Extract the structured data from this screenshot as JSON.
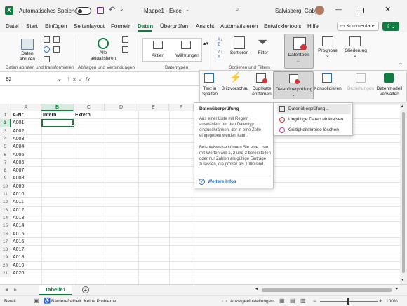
{
  "titlebar": {
    "autosave_label": "Automatisches Speichern",
    "doc_title": "Mappe1 - Excel",
    "user_name": "Salvisberg, Gaby"
  },
  "menu": {
    "tabs": [
      "Datei",
      "Start",
      "Einfügen",
      "Seitenlayout",
      "Formeln",
      "Daten",
      "Überprüfen",
      "Ansicht",
      "Automatisieren",
      "Entwicklertools",
      "Hilfe"
    ],
    "active": "Daten",
    "comments_label": "Kommentare"
  },
  "ribbon": {
    "get_data_label": "Daten abrufen",
    "refresh_all_label": "Alle aktualisieren",
    "stocks_label": "Aktien",
    "currencies_label": "Währungen",
    "sort_label": "Sortieren",
    "filter_label": "Filter",
    "datatools_label": "Datentools",
    "forecast_label": "Prognose",
    "outline_label": "Gliederung",
    "groups": {
      "get_transform": "Daten abrufen und transformieren",
      "queries": "Abfragen und Verbindungen",
      "datatypes": "Datentypen",
      "sort_filter": "Sortieren und Filtern"
    }
  },
  "subribbon": {
    "text_to_columns": "Text in Spalten",
    "flash_fill": "Blitzvorschau",
    "remove_duplicates": "Duplikate entfernen",
    "data_validation": "Datenüberprüfung",
    "consolidate": "Konsolidieren",
    "relationships": "Beziehungen",
    "data_model": "Datenmodell verwalten"
  },
  "formulabar": {
    "name_box": "B2",
    "fx": "fx"
  },
  "columns": [
    "A",
    "B",
    "C",
    "D",
    "E",
    "F"
  ],
  "rows": [
    "1",
    "2",
    "3",
    "4",
    "5",
    "6",
    "7",
    "8",
    "9",
    "10",
    "11",
    "12",
    "13",
    "14",
    "15",
    "16",
    "17",
    "18",
    "19",
    "20",
    "21"
  ],
  "cells": {
    "A1": "A-Nr",
    "B1": "Intern",
    "C1": "Extern",
    "A_values": [
      "A001",
      "A002",
      "A003",
      "A004",
      "A005",
      "A006",
      "A007",
      "A008",
      "A009",
      "A010",
      "A011",
      "A012",
      "A013",
      "A014",
      "A015",
      "A016",
      "A017",
      "A018",
      "A019",
      "A020"
    ]
  },
  "tooltip": {
    "title": "Datenüberprüfung",
    "para1": "Aus einer Liste mit Regeln auswählen, um den Datentyp einzuschränken, der in eine Zelle eingegeben werden kann.",
    "para2": "Beispielsweise können Sie eine Liste mit Werten wie 1, 2 und 3 bereitstellen oder nur Zahlen als gültige Einträge zulassen, die größer als 1000 sind.",
    "more_info": "Weitere Infos"
  },
  "dropdown": {
    "items": [
      "Datenüberprüfung...",
      "Ungültige Daten einkreisen",
      "Gültigkeitskreise löschen"
    ]
  },
  "sheets": {
    "active": "Tabelle1"
  },
  "status": {
    "ready": "Bereit",
    "accessibility": "Barrierefreiheit: Keine Probleme",
    "display_settings": "Anzeigeeinstellungen",
    "zoom": "100%"
  },
  "colors": {
    "excel_green": "#107c41",
    "selected_cell": "#217346",
    "active_tab_underline": "#107c41"
  }
}
